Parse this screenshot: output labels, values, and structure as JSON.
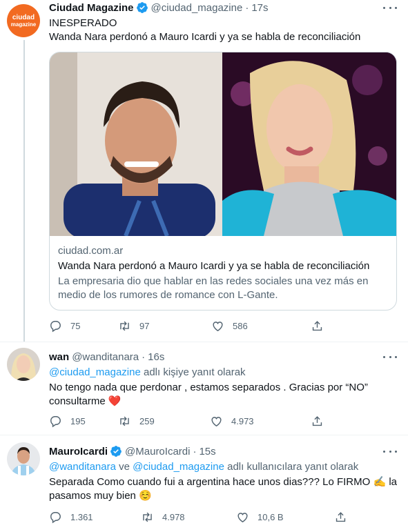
{
  "tweet1": {
    "name": "Ciudad Magazine",
    "handle": "@ciudad_magazine",
    "dot": "·",
    "time": "17s",
    "avatar_label_1": "ciudad",
    "avatar_label_2": "magazine",
    "text_line1": "INESPERADO",
    "text_line2": "Wanda Nara perdonó a Mauro Icardi y ya se habla de reconciliación",
    "card": {
      "domain": "ciudad.com.ar",
      "title": "Wanda Nara perdonó a Mauro Icardi y ya se habla de reconciliación",
      "description": "La empresaria dio que hablar en las redes sociales una vez más en medio de los rumores de romance con L-Gante."
    },
    "stats": {
      "replies": "75",
      "retweets": "97",
      "likes": "586"
    }
  },
  "tweet2": {
    "name": "wan",
    "handle": "@wanditanara",
    "dot": "·",
    "time": "16s",
    "reply_to_handle": "@ciudad_magazine",
    "reply_to_suffix": " adlı kişiye yanıt olarak",
    "text": "No tengo nada que perdonar , estamos separados . Gracias por “NO” consultarme",
    "heart_emoji": "❤️",
    "stats": {
      "replies": "195",
      "retweets": "259",
      "likes": "4.973"
    }
  },
  "tweet3": {
    "name": "MauroIcardi",
    "handle": "@MauroIcardi",
    "dot": "·",
    "time": "15s",
    "reply_handle_1": "@wanditanara",
    "reply_mid": " ve ",
    "reply_handle_2": "@ciudad_magazine",
    "reply_suffix": " adlı kullanıcılara yanıt olarak",
    "text_part1": "Separada Como cuando fui a argentina hace unos dias??? Lo FIRMO ",
    "writing_emoji": "✍️",
    "text_part2": " la pasamos muy bien ",
    "smile_emoji": "☺️",
    "stats": {
      "replies": "1.361",
      "retweets": "4.978",
      "likes": "10,6 B"
    }
  },
  "colors": {
    "accent": "#1d9bf0",
    "muted": "#536471",
    "heart": "#f91880",
    "verified": "#1d9bf0",
    "brand_orange": "#f26a21"
  }
}
